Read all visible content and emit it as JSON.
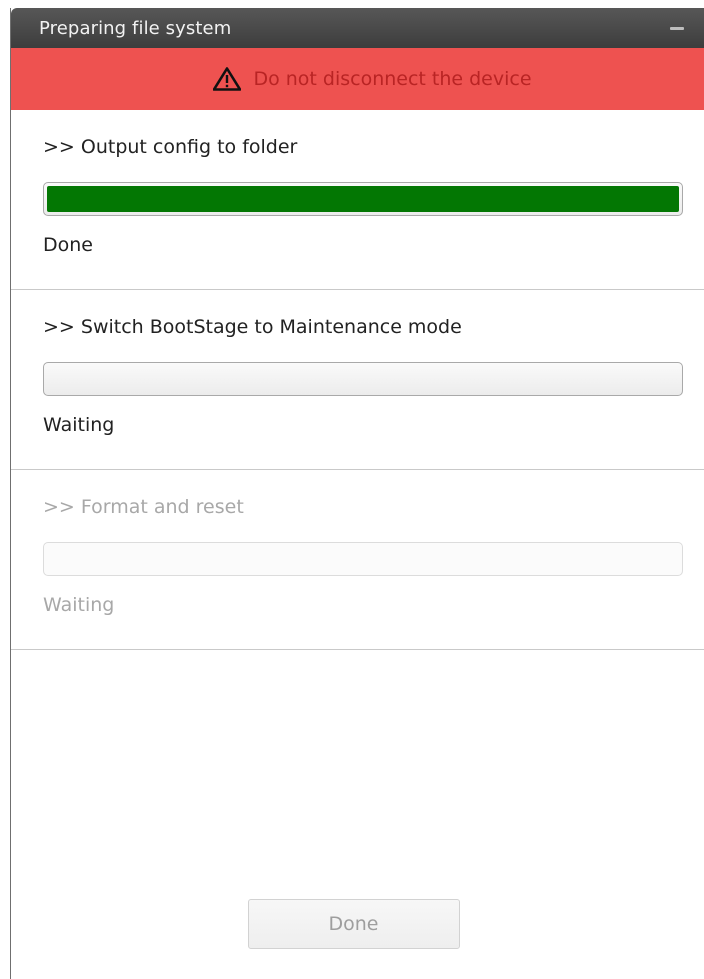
{
  "window": {
    "title": "Preparing file system"
  },
  "warning": {
    "text": "Do not disconnect the device",
    "icon": "warning-triangle-icon",
    "background_color": "#ee5250",
    "text_color": "#b92424"
  },
  "steps": [
    {
      "title": ">> Output config to folder",
      "progress_percent": 100,
      "status": "Done",
      "enabled": true
    },
    {
      "title": ">> Switch BootStage to Maintenance mode",
      "progress_percent": 0,
      "status": "Waiting",
      "enabled": true
    },
    {
      "title": ">> Format and reset",
      "progress_percent": 0,
      "status": "Waiting",
      "enabled": false
    }
  ],
  "progress_color": "#037703",
  "footer": {
    "done_label": "Done",
    "done_enabled": false
  }
}
